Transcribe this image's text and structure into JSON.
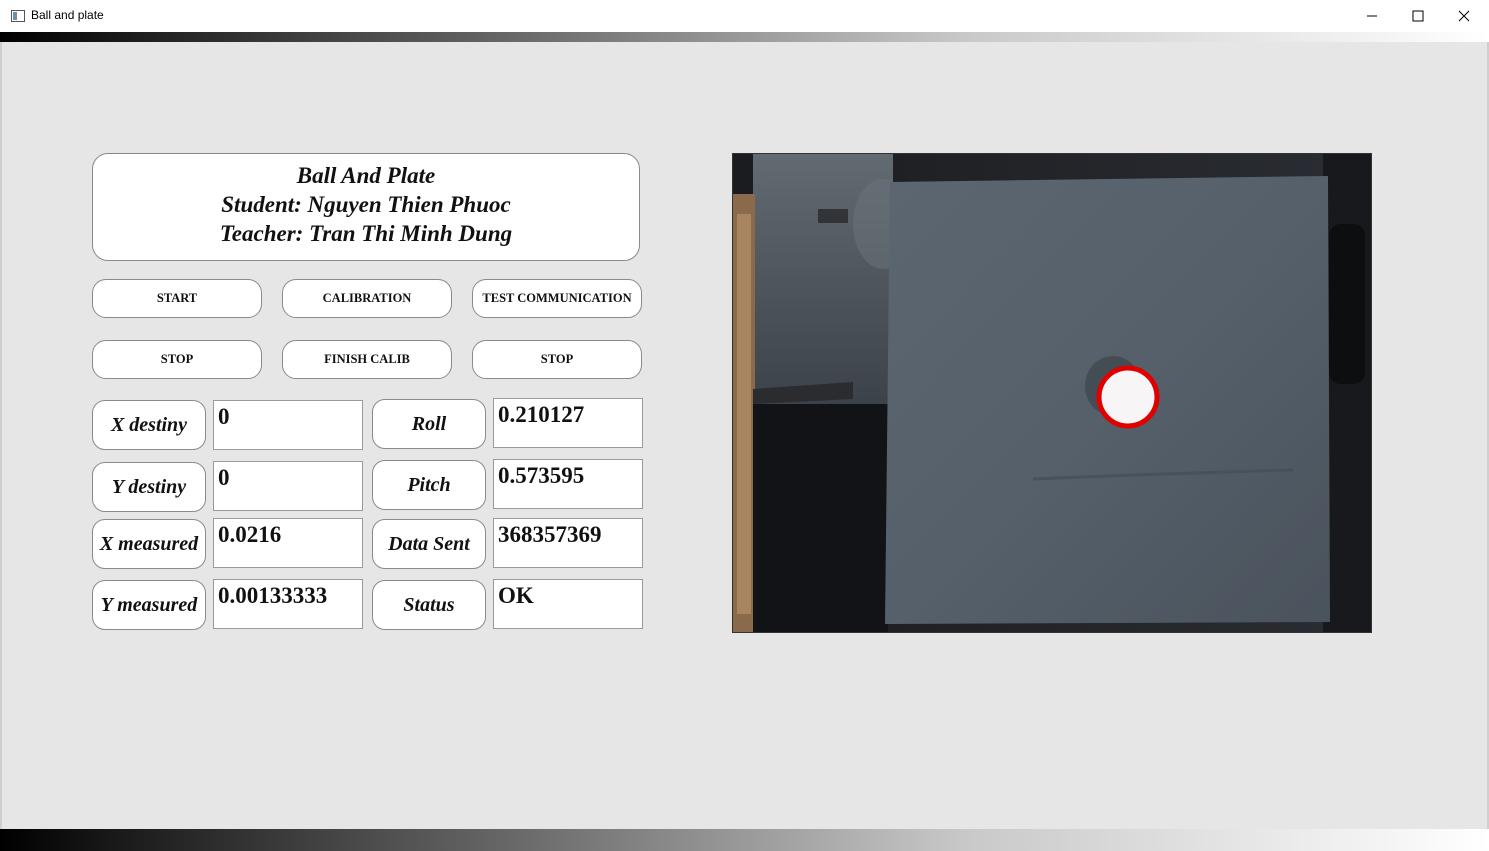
{
  "window": {
    "title": "Ball and plate",
    "minimize_icon": "minimize-icon",
    "maximize_icon": "maximize-icon",
    "close_icon": "close-icon"
  },
  "header": {
    "line1": "Ball And Plate",
    "line2": "Student: Nguyen Thien Phuoc",
    "line3": "Teacher: Tran Thi Minh Dung"
  },
  "buttons": {
    "start": "START",
    "calibration": "CALIBRATION",
    "test_communication": "TEST COMMUNICATION",
    "stop_left": "STOP",
    "finish_calib": "FINISH CALIB",
    "stop_right": "STOP"
  },
  "fields": {
    "x_destiny": {
      "label": "X destiny",
      "value": "0"
    },
    "y_destiny": {
      "label": "Y destiny",
      "value": "0"
    },
    "x_measured": {
      "label": "X measured",
      "value": "0.0216"
    },
    "y_measured": {
      "label": "Y measured",
      "value": "0.00133333"
    },
    "roll": {
      "label": "Roll",
      "value": "0.210127"
    },
    "pitch": {
      "label": "Pitch",
      "value": "0.573595"
    },
    "data_sent": {
      "label": "Data Sent",
      "value": "368357369"
    },
    "status": {
      "label": "Status",
      "value": "OK"
    }
  },
  "colors": {
    "background": "#e6e6e6",
    "ball_outline": "#e00000",
    "plate": "#56606a"
  }
}
